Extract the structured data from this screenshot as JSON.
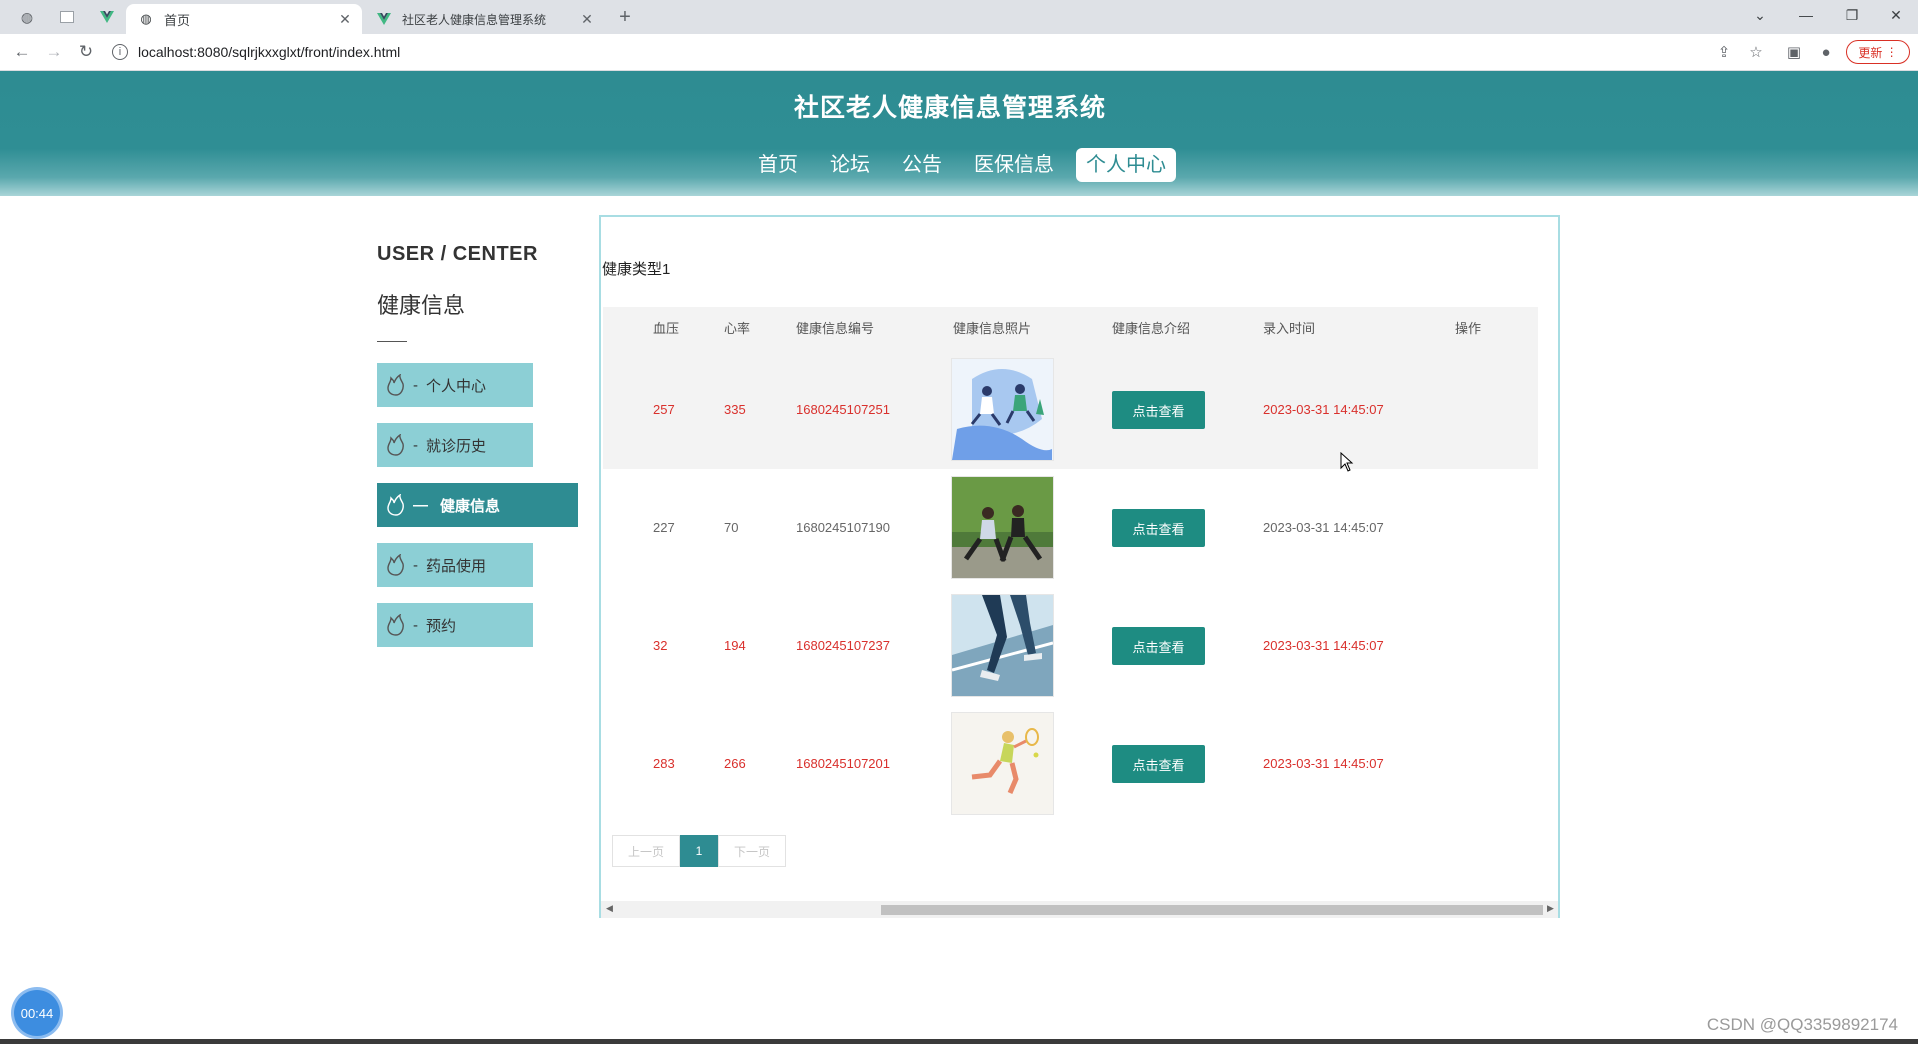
{
  "browser": {
    "tabs": [
      {
        "title": "首页",
        "active": true
      },
      {
        "title": "社区老人健康信息管理系统",
        "active": false
      }
    ],
    "url": "localhost:8080/sqlrjkxxglxt/front/index.html",
    "update_label": "更新"
  },
  "site": {
    "title": "社区老人健康信息管理系统",
    "nav": [
      {
        "label": "首页"
      },
      {
        "label": "论坛"
      },
      {
        "label": "公告"
      },
      {
        "label": "医保信息"
      },
      {
        "label": "个人中心",
        "active": true
      }
    ]
  },
  "sidebar": {
    "title": "USER / CENTER",
    "subtitle": "健康信息",
    "items": [
      {
        "label": "个人中心",
        "icon": "flame-icon"
      },
      {
        "label": "就诊历史",
        "icon": "flame-icon"
      },
      {
        "label": "健康信息",
        "icon": "flame-icon",
        "active": true
      },
      {
        "label": "药品使用",
        "icon": "flame-icon"
      },
      {
        "label": "预约",
        "icon": "flame-icon"
      }
    ]
  },
  "main": {
    "filter_label": "健康类型1",
    "columns": [
      "血压",
      "心率",
      "健康信息编号",
      "健康信息照片",
      "健康信息介绍",
      "录入时间",
      "操作"
    ],
    "rows": [
      {
        "blood_pressure": "257",
        "heart_rate": "335",
        "code": "1680245107251",
        "photo": "people-exercising-illustration",
        "intro_button": "点击查看",
        "time": "2023-03-31 14:45:07"
      },
      {
        "blood_pressure": "227",
        "heart_rate": "70",
        "code": "1680245107190",
        "photo": "couple-stretching-photo",
        "intro_button": "点击查看",
        "time": "2023-03-31 14:45:07"
      },
      {
        "blood_pressure": "32",
        "heart_rate": "194",
        "code": "1680245107237",
        "photo": "treadmill-running-photo",
        "intro_button": "点击查看",
        "time": "2023-03-31 14:45:07"
      },
      {
        "blood_pressure": "283",
        "heart_rate": "266",
        "code": "1680245107201",
        "photo": "tennis-player-illustration",
        "intro_button": "点击查看",
        "time": "2023-03-31 14:45:07"
      }
    ],
    "pager": {
      "prev": "上一页",
      "current": "1",
      "next": "下一页"
    }
  },
  "overlay": {
    "timer": "00:44",
    "watermark": "CSDN @QQ3359892174"
  },
  "colors": {
    "brand": "#2e8c92",
    "sidebar_item": "#8ccfd5",
    "button": "#1e8c82",
    "accent_red": "#d9302c"
  }
}
